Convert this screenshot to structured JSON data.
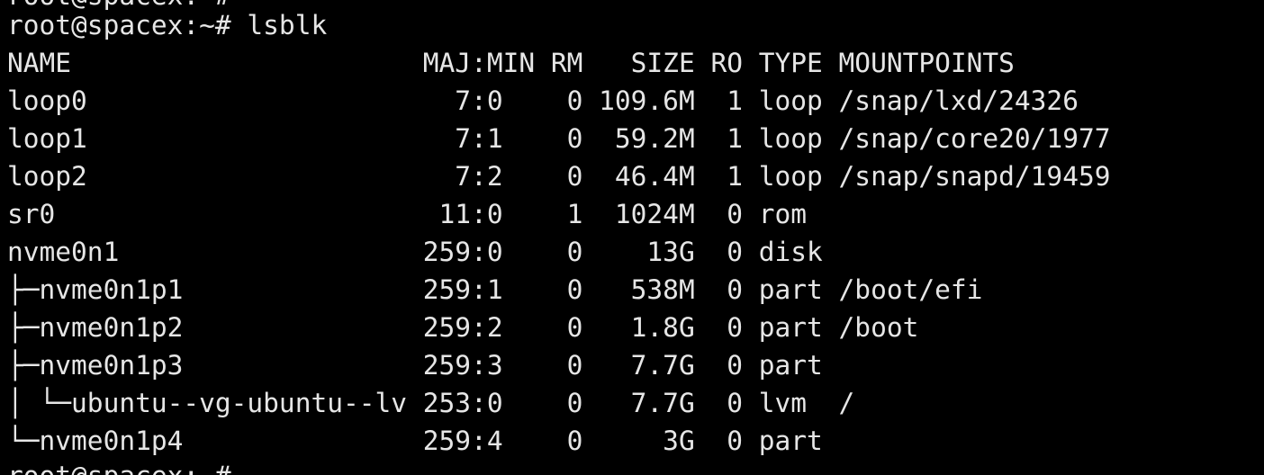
{
  "terminal": {
    "prev_prompt": "root@spacex:~#",
    "command_line": "root@spacex:~# lsblk",
    "header": "NAME                      MAJ:MIN RM   SIZE RO TYPE MOUNTPOINTS",
    "rows": [
      "loop0                       7:0    0 109.6M  1 loop /snap/lxd/24326",
      "loop1                       7:1    0  59.2M  1 loop /snap/core20/1977",
      "loop2                       7:2    0  46.4M  1 loop /snap/snapd/19459",
      "sr0                        11:0    1  1024M  0 rom",
      "nvme0n1                   259:0    0    13G  0 disk",
      "├─nvme0n1p1               259:1    0   538M  0 part /boot/efi",
      "├─nvme0n1p2               259:2    0   1.8G  0 part /boot",
      "├─nvme0n1p3               259:3    0   7.7G  0 part",
      "│ └─ubuntu--vg-ubuntu--lv 253:0    0   7.7G  0 lvm  /",
      "└─nvme0n1p4               259:4    0     3G  0 part"
    ],
    "next_prompt": "root@spacex:~#"
  }
}
